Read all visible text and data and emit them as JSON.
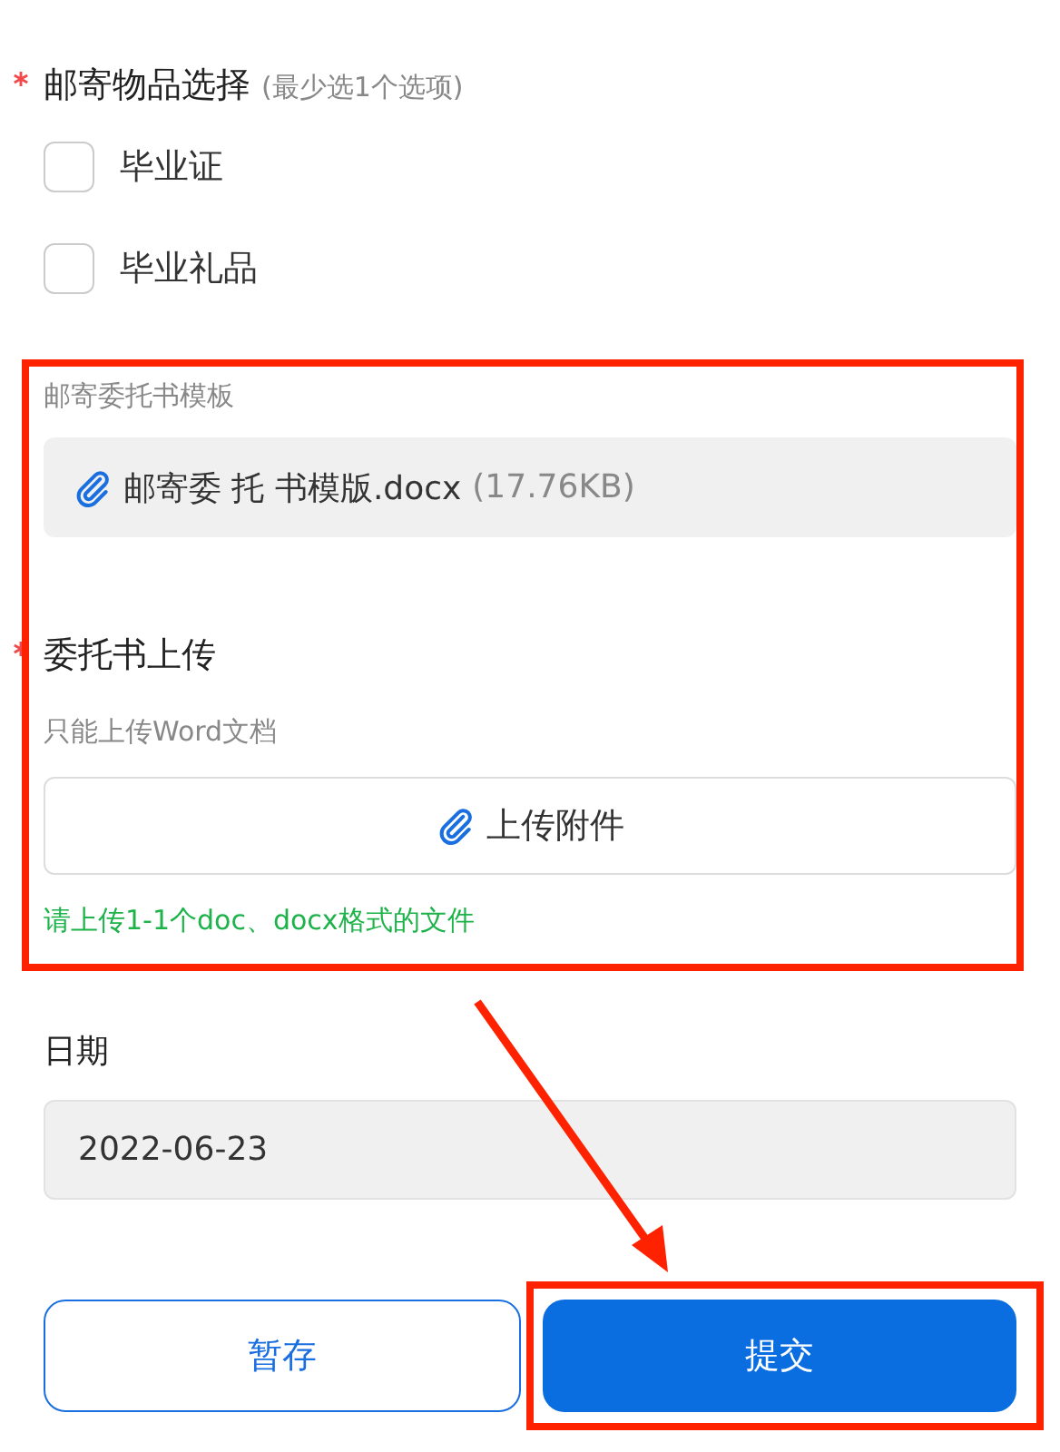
{
  "form": {
    "mail_items": {
      "label": "邮寄物品选择",
      "required": true,
      "hint": "(最少选1个选项)",
      "options": [
        {
          "label": "毕业证",
          "checked": false
        },
        {
          "label": "毕业礼品",
          "checked": false
        }
      ]
    },
    "template": {
      "label": "邮寄委托书模板",
      "file_name": "邮寄委 托 书模版.docx",
      "file_size": "(17.76KB)"
    },
    "upload": {
      "label": "委托书上传",
      "required": true,
      "hint": "只能上传Word文档",
      "button": "上传附件",
      "note": "请上传1-1个doc、docx格式的文件"
    },
    "date": {
      "label": "日期",
      "value": "2022-06-23"
    },
    "buttons": [
      {
        "label": "暂存",
        "kind": "secondary"
      },
      {
        "label": "提交",
        "kind": "primary"
      }
    ]
  }
}
